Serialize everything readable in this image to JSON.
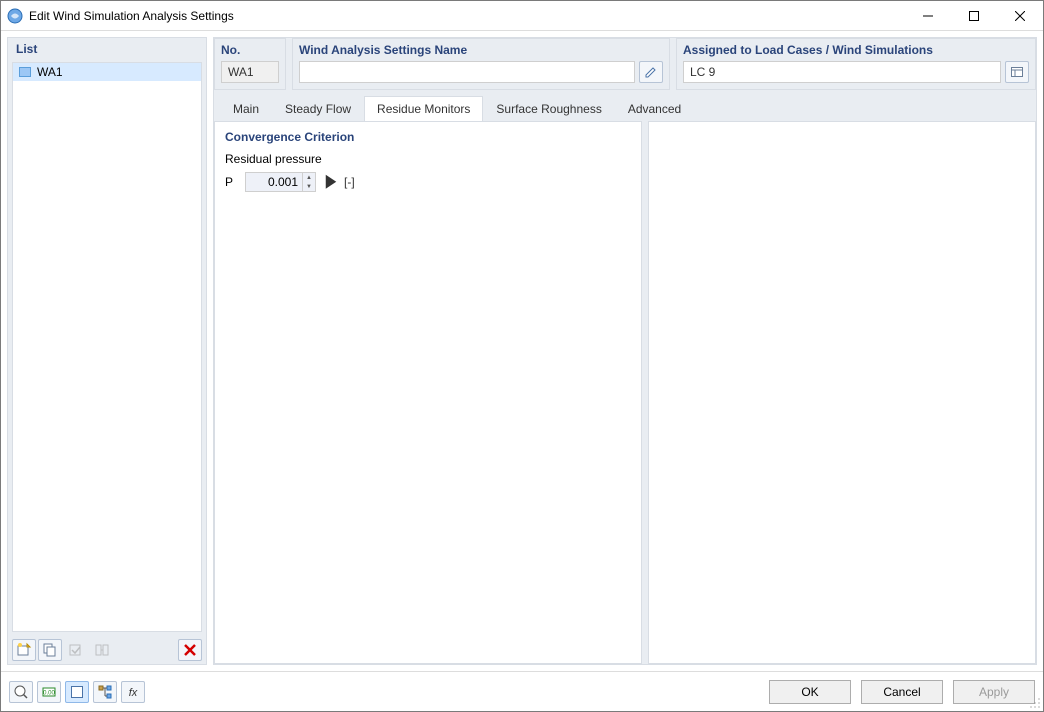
{
  "window": {
    "title": "Edit Wind Simulation Analysis Settings"
  },
  "list": {
    "header": "List",
    "items": [
      {
        "label": "WA1"
      }
    ]
  },
  "fields": {
    "no": {
      "label": "No.",
      "value": "WA1"
    },
    "name": {
      "label": "Wind Analysis Settings Name",
      "value": ""
    },
    "assigned": {
      "label": "Assigned to Load Cases / Wind Simulations",
      "value": "LC 9"
    }
  },
  "tabs": {
    "items": [
      {
        "label": "Main"
      },
      {
        "label": "Steady Flow"
      },
      {
        "label": "Residue Monitors"
      },
      {
        "label": "Surface Roughness"
      },
      {
        "label": "Advanced"
      }
    ],
    "active_index": 2
  },
  "content": {
    "section_title": "Convergence Criterion",
    "residual_label": "Residual pressure",
    "symbol": "P",
    "value": "0.001",
    "unit": "[-]"
  },
  "footer": {
    "ok": "OK",
    "cancel": "Cancel",
    "apply": "Apply"
  }
}
